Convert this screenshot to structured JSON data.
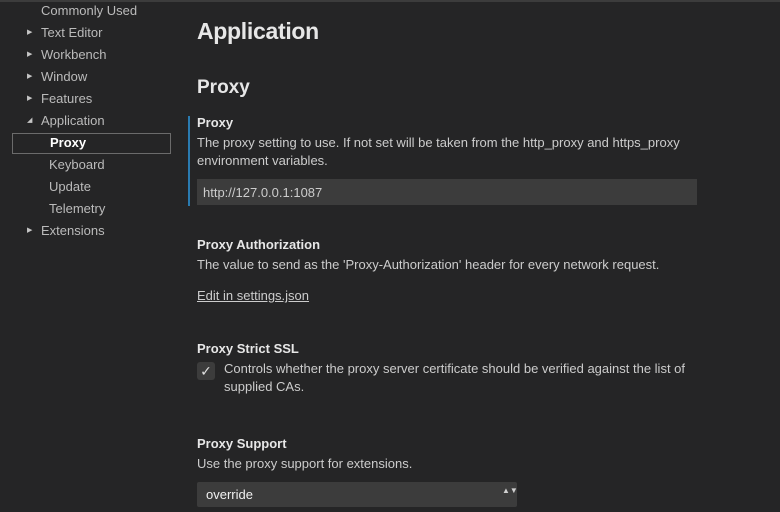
{
  "tree": {
    "items": [
      {
        "label": "Commonly Used",
        "twisty": ""
      },
      {
        "label": "Text Editor",
        "twisty": "▶"
      },
      {
        "label": "Workbench",
        "twisty": "▶"
      },
      {
        "label": "Window",
        "twisty": "▶"
      },
      {
        "label": "Features",
        "twisty": "▶"
      },
      {
        "label": "Application",
        "twisty": "◢"
      },
      {
        "label": "Proxy",
        "twisty": ""
      },
      {
        "label": "Keyboard",
        "twisty": ""
      },
      {
        "label": "Update",
        "twisty": ""
      },
      {
        "label": "Telemetry",
        "twisty": ""
      },
      {
        "label": "Extensions",
        "twisty": "▶"
      }
    ]
  },
  "main": {
    "page_title": "Application",
    "section_title": "Proxy",
    "proxy": {
      "title": "Proxy",
      "description": "The proxy setting to use. If not set will be taken from the http_proxy and https_proxy environment variables.",
      "value": "http://127.0.0.1:1087"
    },
    "proxy_authorization": {
      "title": "Proxy Authorization",
      "description": "The value to send as the 'Proxy-Authorization' header for every network request.",
      "link": "Edit in settings.json"
    },
    "proxy_strict_ssl": {
      "title": "Proxy Strict SSL",
      "check_glyph": "✓",
      "description": "Controls whether the proxy server certificate should be verified against the list of supplied CAs."
    },
    "proxy_support": {
      "title": "Proxy Support",
      "description": "Use the proxy support for extensions.",
      "selected": "override",
      "arrow_glyphs": "▲▼"
    }
  },
  "colors": {
    "background": "#252526",
    "input_background": "#3c3c3c",
    "focus_accent": "#2a7bb0"
  }
}
